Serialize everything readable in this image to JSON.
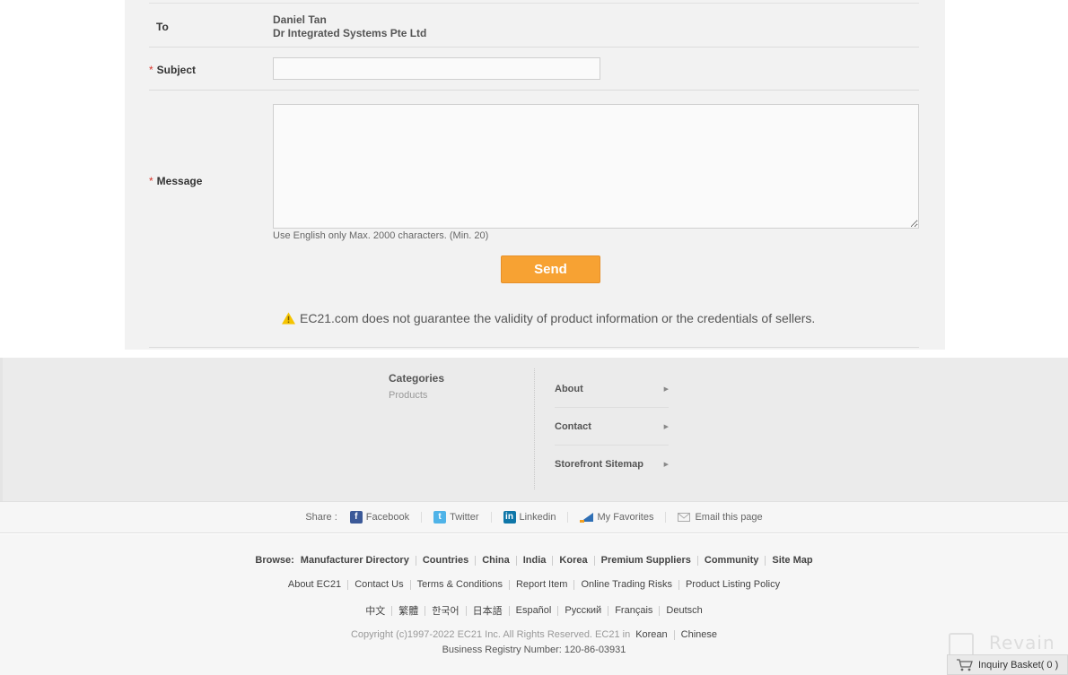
{
  "form": {
    "to_label": "To",
    "to_name": "Daniel Tan",
    "to_company": "Dr Integrated Systems Pte Ltd",
    "required_mark": "*",
    "subject_label": "Subject",
    "subject_value": "",
    "message_label": "Message",
    "message_value": "",
    "message_hint": "Use English only Max. 2000 characters. (Min. 20)",
    "send_label": "Send",
    "notice": "EC21.com does not guarantee the validity of product information or the credentials of sellers."
  },
  "footer_nav": {
    "categories_title": "Categories",
    "categories_item": "Products",
    "store_links": [
      "About",
      "Contact",
      "Storefront Sitemap"
    ],
    "arrow_glyph": "▶"
  },
  "share": {
    "label": "Share :",
    "items": [
      {
        "label": "Facebook",
        "icon": "facebook-icon",
        "glyph": "f"
      },
      {
        "label": "Twitter",
        "icon": "twitter-icon",
        "glyph": "t"
      },
      {
        "label": "Linkedin",
        "icon": "linkedin-icon",
        "glyph": "in"
      },
      {
        "label": "My Favorites",
        "icon": "favorites-icon"
      },
      {
        "label": "Email this page",
        "icon": "email-icon"
      }
    ]
  },
  "bottom_links": {
    "browse_label": "Browse:",
    "browse": [
      "Manufacturer Directory",
      "Countries",
      "China",
      "India",
      "Korea",
      "Premium Suppliers",
      "Community",
      "Site Map"
    ],
    "misc": [
      "About EC21",
      "Contact Us",
      "Terms & Conditions",
      "Report Item",
      "Online Trading Risks",
      "Product Listing Policy"
    ],
    "languages": [
      "中文",
      "繁體",
      "한국어",
      "日本語",
      "Español",
      "Русский",
      "Français",
      "Deutsch"
    ],
    "copyright": "Copyright (c)1997-2022 EC21 Inc. All Rights Reserved. EC21 in",
    "copyright_links": [
      "Korean",
      "Chinese"
    ],
    "registry": "Business Registry Number: 120-86-03931"
  },
  "basket": {
    "label": "Inquiry Basket( 0 )"
  },
  "watermark": "Revain",
  "colors": {
    "send_button": "#f7a233",
    "required_mark": "#d9352b",
    "panel_bg": "#f2f2f2"
  }
}
